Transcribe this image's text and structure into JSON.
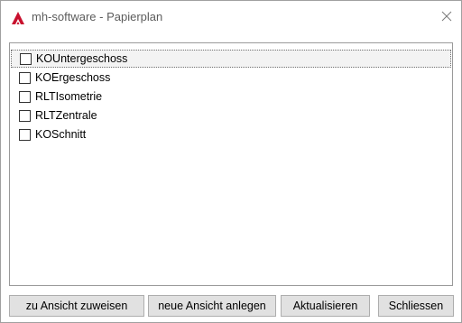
{
  "window": {
    "title": "mh-software - Papierplan",
    "close_glyph": "×",
    "app_icon": "autocad-logo-icon",
    "accent_color": "#c8102e"
  },
  "list": {
    "items": [
      {
        "label": "KOUntergeschoss",
        "checked": false,
        "focused": true
      },
      {
        "label": "KOErgeschoss",
        "checked": false,
        "focused": false
      },
      {
        "label": "RLTIsometrie",
        "checked": false,
        "focused": false
      },
      {
        "label": "RLTZentrale",
        "checked": false,
        "focused": false
      },
      {
        "label": "KOSchnitt",
        "checked": false,
        "focused": false
      }
    ]
  },
  "buttons": {
    "assign_label": "zu Ansicht zuweisen",
    "new_view_label": "neue Ansicht anlegen",
    "refresh_label": "Aktualisieren",
    "close_label": "Schliessen"
  }
}
